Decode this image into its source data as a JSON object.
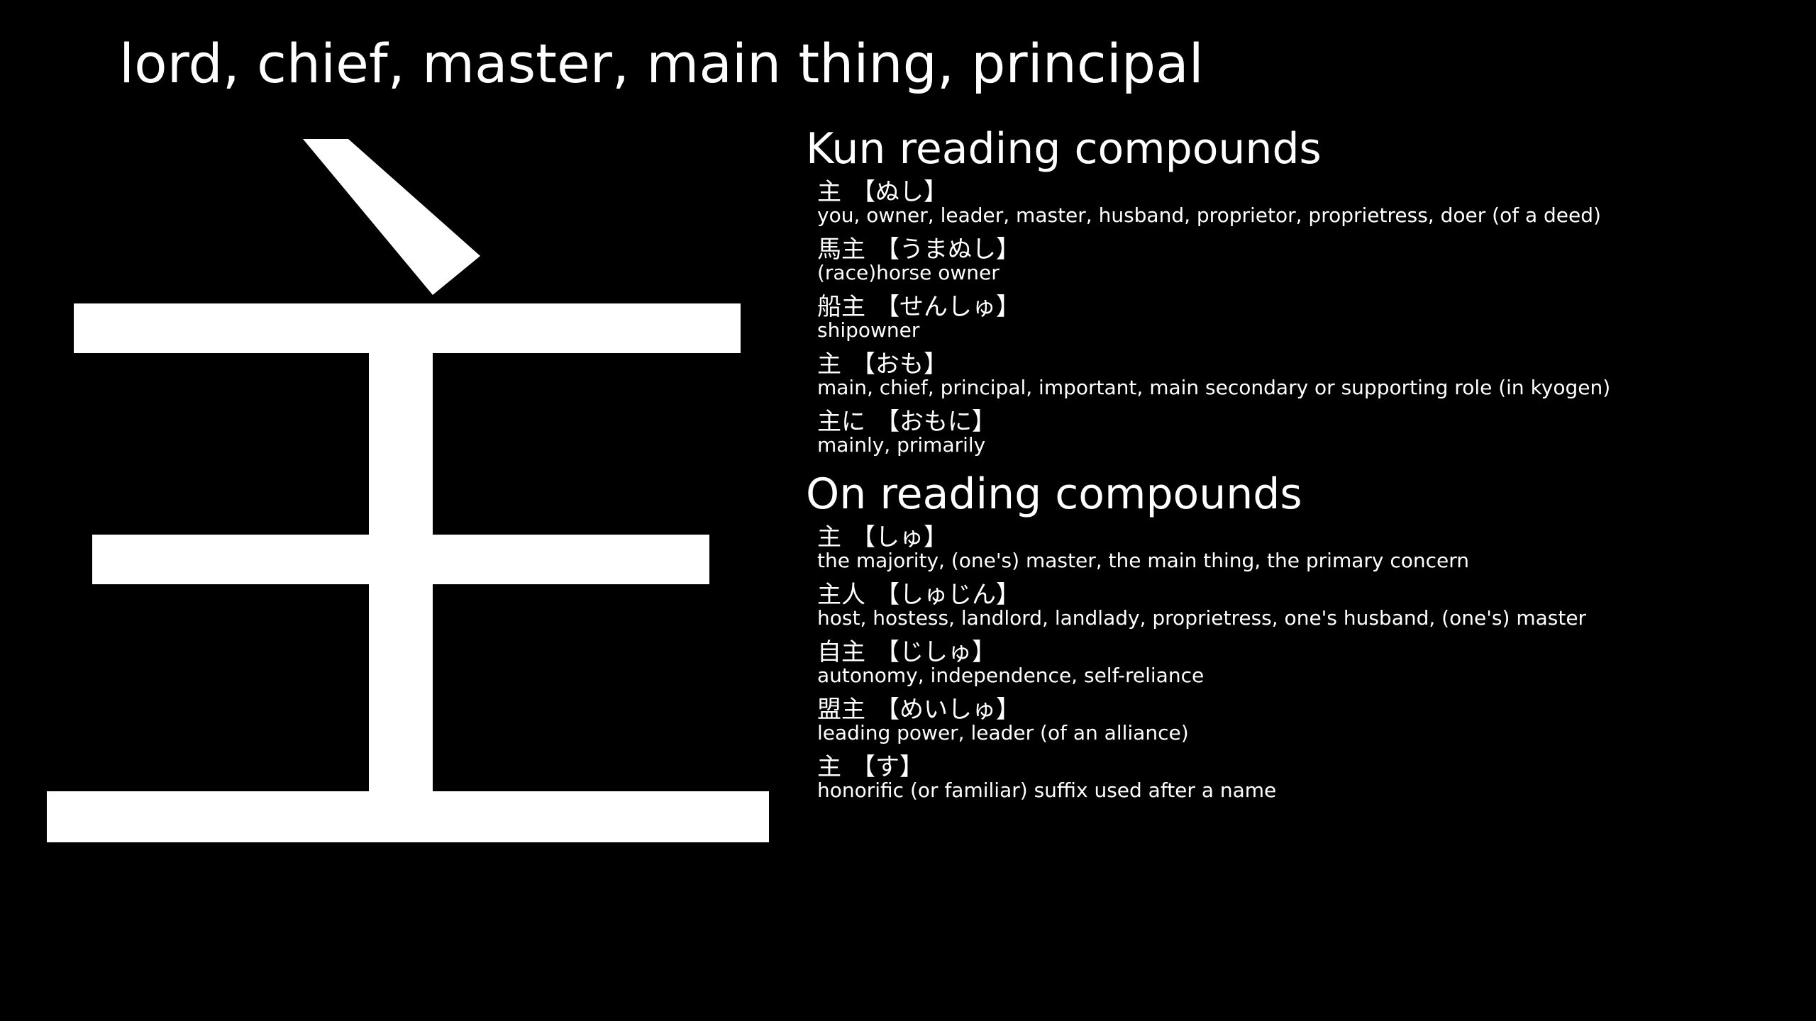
{
  "colors": {
    "background": "#000000",
    "text": "#ffffff"
  },
  "kanji": "主",
  "meaning": "lord, chief, master, main thing, principal",
  "kun": {
    "heading": "Kun reading compounds",
    "items": [
      {
        "word": "主",
        "reading": "【ぬし】",
        "gloss": "you, owner, leader, master, husband, proprietor, proprietress, doer (of a deed)"
      },
      {
        "word": "馬主",
        "reading": "【うまぬし】",
        "gloss": "(race)horse owner"
      },
      {
        "word": "船主",
        "reading": "【せんしゅ】",
        "gloss": "shipowner"
      },
      {
        "word": "主",
        "reading": "【おも】",
        "gloss": "main, chief, principal, important, main secondary or supporting role (in kyogen)"
      },
      {
        "word": "主に",
        "reading": "【おもに】",
        "gloss": "mainly, primarily"
      }
    ]
  },
  "on": {
    "heading": "On reading compounds",
    "items": [
      {
        "word": "主",
        "reading": "【しゅ】",
        "gloss": "the majority, (one's) master, the main thing, the primary concern"
      },
      {
        "word": "主人",
        "reading": "【しゅじん】",
        "gloss": "host, hostess, landlord, landlady, proprietress, one's husband, (one's) master"
      },
      {
        "word": "自主",
        "reading": "【じしゅ】",
        "gloss": "autonomy, independence, self-reliance"
      },
      {
        "word": "盟主",
        "reading": "【めいしゅ】",
        "gloss": "leading power, leader (of an alliance)"
      },
      {
        "word": "主",
        "reading": "【す】",
        "gloss": "honorific (or familiar) suffix used after a name"
      }
    ]
  }
}
